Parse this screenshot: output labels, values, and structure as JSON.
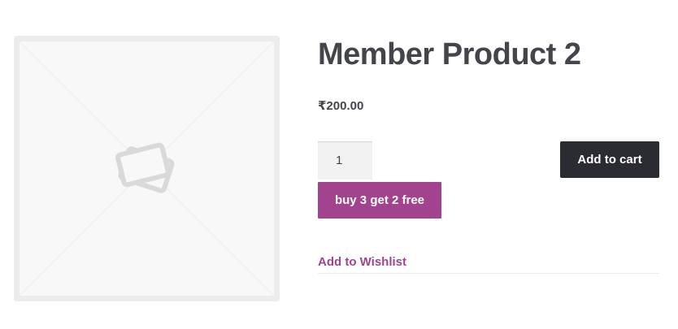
{
  "product": {
    "title": "Member Product 2",
    "price": "₹200.00",
    "image_icon": "image-placeholder-icon"
  },
  "cart_form": {
    "quantity_value": "1",
    "add_to_cart_label": "Add to cart",
    "promo_label": "buy 3 get 2 free"
  },
  "wishlist": {
    "label": "Add to Wishlist"
  },
  "colors": {
    "title": "#43454b",
    "accent": "#a2438d",
    "dark_button": "#2b2b32",
    "placeholder_bg": "#f8f8f8",
    "placeholder_border": "#ececec"
  }
}
